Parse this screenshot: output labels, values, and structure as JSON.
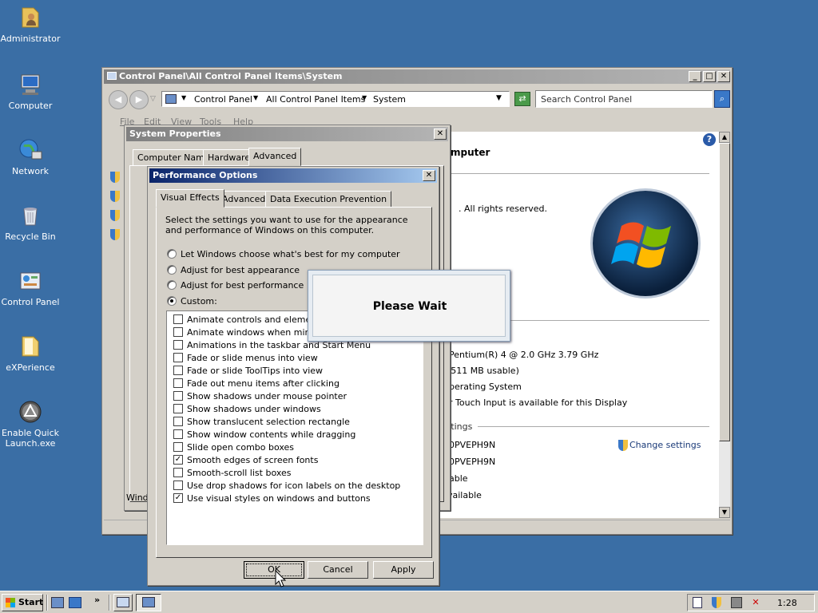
{
  "desktop": {
    "icons": [
      {
        "label": "Administrator"
      },
      {
        "label": "Computer"
      },
      {
        "label": "Network"
      },
      {
        "label": "Recycle Bin"
      },
      {
        "label": "Control Panel"
      },
      {
        "label": "eXPerience"
      },
      {
        "label": "Enable Quick Launch.exe"
      }
    ]
  },
  "control_panel": {
    "title": "Control Panel\\All Control Panel Items\\System",
    "breadcrumb": [
      "Control Panel",
      "All Control Panel Items",
      "System"
    ],
    "search_placeholder": "Search Control Panel",
    "menu": [
      "File",
      "Edit",
      "View",
      "Tools",
      "Help"
    ],
    "heading_fragment": "mputer",
    "rights_text": ".  All rights reserved.",
    "system_lines": [
      "ailable",
      "Pentium(R) 4   @ 2.0 GHz   3.79 GHz",
      "(511 MB usable)",
      "perating System",
      "r Touch Input is available for this Display"
    ],
    "settings_heading": "ttings",
    "computer_lines": [
      "0PVEPH9N",
      "0PVEPH9N",
      "able",
      "vailable"
    ],
    "change_settings": "Change settings",
    "help_icon": "help-icon"
  },
  "system_properties": {
    "title": "System Properties",
    "tabs": [
      "Computer Name",
      "Hardware",
      "Advanced"
    ],
    "footer_fragment": "Windo"
  },
  "performance_options": {
    "title": "Performance Options",
    "tabs": [
      "Visual Effects",
      "Advanced",
      "Data Execution Prevention"
    ],
    "description": "Select the settings you want to use for the appearance and performance of Windows on this computer.",
    "radios": [
      {
        "label": "Let Windows choose what's best for my computer",
        "checked": false
      },
      {
        "label": "Adjust for best appearance",
        "checked": false
      },
      {
        "label": "Adjust for best performance",
        "checked": false
      },
      {
        "label": "Custom:",
        "checked": true
      }
    ],
    "effects": [
      {
        "label": "Animate controls and elements i",
        "checked": false
      },
      {
        "label": "Animate windows when minimizi",
        "checked": false
      },
      {
        "label": "Animations in the taskbar and Start Menu",
        "checked": false
      },
      {
        "label": "Fade or slide menus into view",
        "checked": false
      },
      {
        "label": "Fade or slide ToolTips into view",
        "checked": false
      },
      {
        "label": "Fade out menu items after clicking",
        "checked": false
      },
      {
        "label": "Show shadows under mouse pointer",
        "checked": false
      },
      {
        "label": "Show shadows under windows",
        "checked": false
      },
      {
        "label": "Show translucent selection rectangle",
        "checked": false
      },
      {
        "label": "Show window contents while dragging",
        "checked": false
      },
      {
        "label": "Slide open combo boxes",
        "checked": false
      },
      {
        "label": "Smooth edges of screen fonts",
        "checked": true
      },
      {
        "label": "Smooth-scroll list boxes",
        "checked": false
      },
      {
        "label": "Use drop shadows for icon labels on the desktop",
        "checked": false
      },
      {
        "label": "Use visual styles on windows and buttons",
        "checked": true
      }
    ],
    "buttons": {
      "ok": "OK",
      "cancel": "Cancel",
      "apply": "Apply"
    }
  },
  "please_wait": {
    "text": "Please Wait"
  },
  "taskbar": {
    "start": "Start",
    "chevron": "»",
    "clock": "1:28"
  },
  "colors": {
    "desktop": "#3a6ea5",
    "title_active": "#0a246a",
    "title_inactive": "#808080",
    "face": "#d4d0c8"
  }
}
